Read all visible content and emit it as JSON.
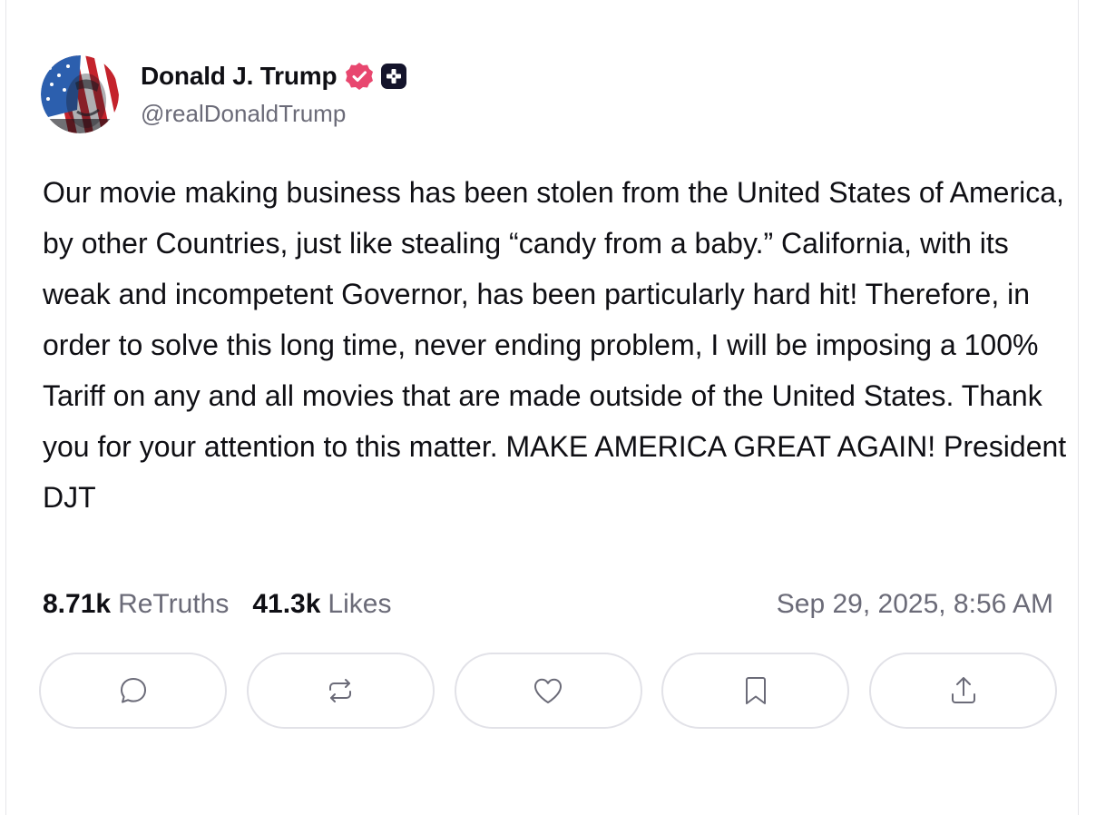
{
  "header_cut_text": "",
  "author": {
    "display_name": "Donald J. Trump",
    "handle": "@realDonaldTrump"
  },
  "post": {
    "text": "Our movie making business has been stolen from the United States of America, by other Countries, just like stealing “candy from a baby.” California, with its weak and incompetent Governor, has been particularly hard hit! Therefore, in order to solve this long time, never ending problem, I will be imposing a 100% Tariff on any and all movies that are made outside of the United States. Thank you for your attention to this matter. MAKE AMERICA GREAT AGAIN! President DJT"
  },
  "stats": {
    "retruths_count": "8.71k",
    "retruths_label": "ReTruths",
    "likes_count": "41.3k",
    "likes_label": "Likes",
    "timestamp": "Sep 29, 2025, 8:56 AM"
  },
  "actions": [
    {
      "icon": "reply-icon"
    },
    {
      "icon": "retruth-icon"
    },
    {
      "icon": "like-icon"
    },
    {
      "icon": "bookmark-icon"
    },
    {
      "icon": "share-icon"
    }
  ],
  "colors": {
    "verified_badge": "#e8476f",
    "plus_badge": "#14142b",
    "muted_text": "#6b6b78",
    "button_border": "#e2e2e8"
  }
}
